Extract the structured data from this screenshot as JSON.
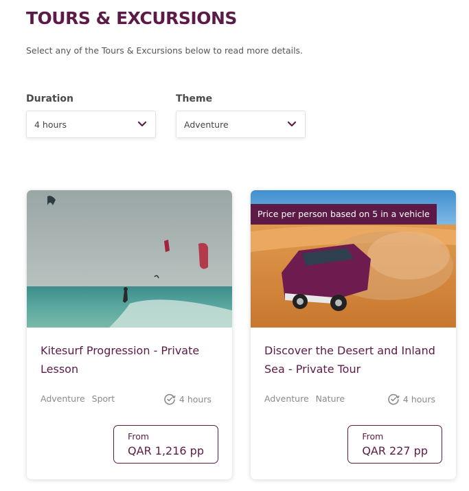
{
  "page": {
    "title": "TOURS & EXCURSIONS",
    "subtitle": "Select any of the Tours & Excursions below to read more details."
  },
  "filters": {
    "duration": {
      "label": "Duration",
      "value": "4 hours"
    },
    "theme": {
      "label": "Theme",
      "value": "Adventure"
    }
  },
  "cards": [
    {
      "title": "Kitesurf Progression - Private Lesson",
      "tags": [
        "Adventure",
        "Sport"
      ],
      "duration": "4 hours",
      "price_from": "From",
      "price": "QAR 1,216 pp"
    },
    {
      "badge": "Price per person based on 5 in a vehicle",
      "title": "Discover the Desert and Inland Sea - Private Tour",
      "tags": [
        "Adventure",
        "Nature"
      ],
      "duration": "4 hours",
      "price_from": "From",
      "price": "QAR 227 pp"
    }
  ],
  "colors": {
    "brand": "#5c1a47",
    "muted": "#8a8a8a"
  },
  "icons": {
    "select": "chevron-down-icon",
    "duration": "clock-check-icon"
  }
}
